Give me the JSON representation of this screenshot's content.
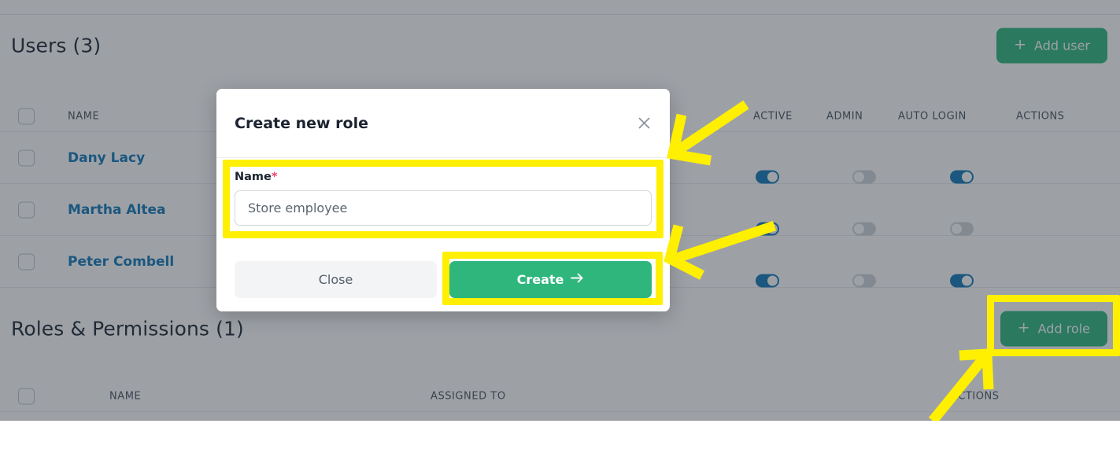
{
  "users_section": {
    "title": "Users (3)",
    "add_button": {
      "label": "Add user",
      "icon": "plus-icon"
    },
    "columns": [
      "NAME",
      "ACTIVE",
      "ADMIN",
      "AUTO LOGIN",
      "ACTIONS"
    ],
    "rows": [
      {
        "name": "Dany Lacy",
        "active": true,
        "admin": false,
        "auto_login": true
      },
      {
        "name": "Martha Altea",
        "active": true,
        "admin": false,
        "auto_login": false
      },
      {
        "name": "Peter Combell",
        "active": true,
        "admin": false,
        "auto_login": true
      }
    ]
  },
  "roles_section": {
    "title": "Roles & Permissions (1)",
    "add_button": {
      "label": "Add role",
      "icon": "plus-icon"
    },
    "columns": [
      "NAME",
      "ASSIGNED TO",
      "ACTIONS"
    ]
  },
  "modal": {
    "title": "Create new role",
    "close_icon": "close-icon",
    "field": {
      "label": "Name",
      "required_mark": "*",
      "value": "",
      "placeholder": "Store employee"
    },
    "buttons": {
      "close": "Close",
      "create": "Create",
      "create_icon": "arrow-right-icon"
    }
  },
  "colors": {
    "accent_green": "#2eb67d",
    "link_blue": "#1076b8",
    "toggle_on": "#1076b8",
    "toggle_off": "#ced3d9",
    "required_red": "#f23e6e",
    "annotation_yellow": "#ffef00",
    "overlay": "rgba(42,50,62,0.46)"
  }
}
